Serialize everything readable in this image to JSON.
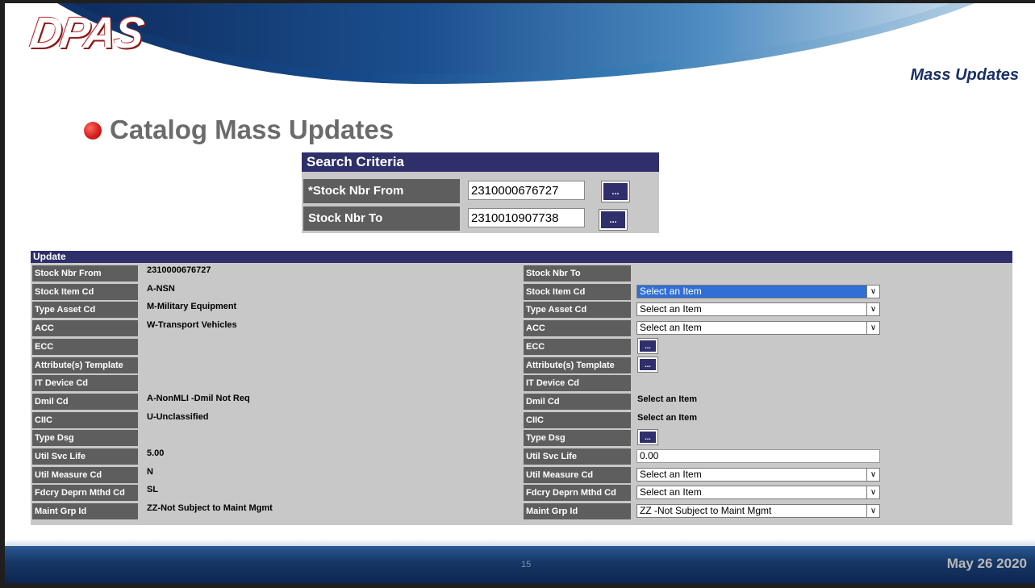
{
  "header": {
    "logo": "DPAS",
    "section": "Mass Updates",
    "title": "Catalog Mass Updates"
  },
  "search": {
    "heading": "Search  Criteria",
    "from_label": "*Stock Nbr From",
    "from_value": "2310000676727",
    "to_label": "Stock Nbr To",
    "to_value": "2310010907738",
    "lookup_btn": "..."
  },
  "update": {
    "heading": "Update",
    "rows": [
      {
        "left_label": "Stock Nbr From",
        "left_value": "2310000676727",
        "right_label": "Stock Nbr To",
        "right_type": "none",
        "right_value": ""
      },
      {
        "left_label": "Stock Item Cd",
        "left_value": "A-NSN",
        "right_label": "Stock Item Cd",
        "right_type": "select",
        "right_value": "Select an Item"
      },
      {
        "left_label": "Type Asset Cd",
        "left_value": "M-Military Equipment",
        "right_label": "Type Asset Cd",
        "right_type": "select",
        "right_value": "Select an Item"
      },
      {
        "left_label": "ACC",
        "left_value": "W-Transport Vehicles",
        "right_label": "ACC",
        "right_type": "select",
        "right_value": "Select an Item"
      },
      {
        "left_label": "ECC",
        "left_value": "",
        "right_label": "ECC",
        "right_type": "button",
        "right_value": "..."
      },
      {
        "left_label": "Attribute(s) Template",
        "left_value": "",
        "right_label": "Attribute(s) Template",
        "right_type": "button",
        "right_value": "..."
      },
      {
        "left_label": "IT Device Cd",
        "left_value": "",
        "right_label": "IT Device Cd",
        "right_type": "none",
        "right_value": ""
      },
      {
        "left_label": "Dmil Cd",
        "left_value": "A-NonMLI -Dmil Not Req",
        "right_label": "Dmil Cd",
        "right_type": "text",
        "right_value": "Select an Item"
      },
      {
        "left_label": "CIIC",
        "left_value": "U-Unclassified",
        "right_label": "CIIC",
        "right_type": "text",
        "right_value": "Select an Item"
      },
      {
        "left_label": "Type Dsg",
        "left_value": "",
        "right_label": "Type Dsg",
        "right_type": "button",
        "right_value": "..."
      },
      {
        "left_label": "Util Svc Life",
        "left_value": "5.00",
        "right_label": "Util Svc Life",
        "right_type": "input",
        "right_value": "0.00"
      },
      {
        "left_label": "Util Measure Cd",
        "left_value": "N",
        "right_label": "Util Measure Cd",
        "right_type": "select",
        "right_value": "Select an Item"
      },
      {
        "left_label": "Fdcry Deprn Mthd Cd",
        "left_value": "SL",
        "right_label": "Fdcry Deprn Mthd Cd",
        "right_type": "select",
        "right_value": "Select an Item"
      },
      {
        "left_label": "Maint Grp Id",
        "left_value": "ZZ-Not Subject to Maint Mgmt",
        "right_label": "Maint Grp Id",
        "right_type": "select",
        "right_value": "ZZ -Not Subject to Maint Mgmt"
      }
    ]
  },
  "footer": {
    "page": "15",
    "date": "May 26 2020"
  },
  "colors": {
    "panel_header": "#2f2f6b",
    "label_bg": "#5e5e5e",
    "panel_bg": "#c8c8c8",
    "selected_option": "#2f6fd6",
    "bullet": "#d61f1f"
  }
}
